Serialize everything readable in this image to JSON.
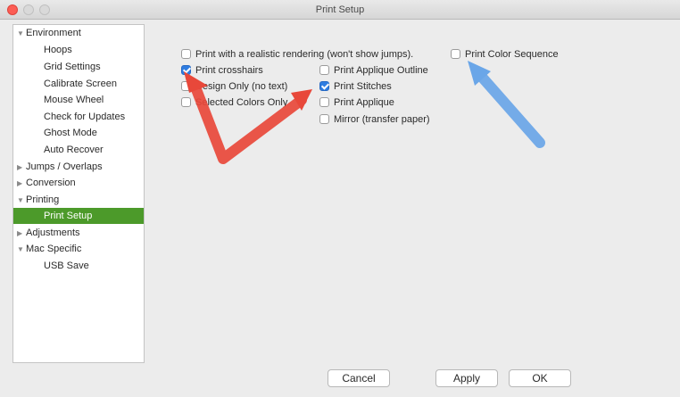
{
  "window": {
    "title": "Print Setup"
  },
  "sidebar": {
    "items": [
      {
        "label": "Environment",
        "expander": "open"
      },
      {
        "label": "Hoops"
      },
      {
        "label": "Grid Settings"
      },
      {
        "label": "Calibrate Screen"
      },
      {
        "label": "Mouse Wheel"
      },
      {
        "label": "Check for Updates"
      },
      {
        "label": "Ghost Mode"
      },
      {
        "label": "Auto Recover"
      },
      {
        "label": "Jumps / Overlaps",
        "expander": "closed"
      },
      {
        "label": "Conversion",
        "expander": "closed"
      },
      {
        "label": "Printing",
        "expander": "open"
      },
      {
        "label": "Print Setup",
        "selected": true
      },
      {
        "label": "Adjustments",
        "expander": "closed"
      },
      {
        "label": "Mac Specific",
        "expander": "open"
      },
      {
        "label": "USB Save"
      }
    ]
  },
  "options": {
    "realistic": {
      "label": "Print with a realistic rendering (won't show jumps).",
      "checked": false
    },
    "crosshairs": {
      "label": "Print crosshairs",
      "checked": true
    },
    "design_only": {
      "label": "Design Only (no text)",
      "checked": false
    },
    "selected_colors": {
      "label": "Selected Colors Only",
      "checked": false
    },
    "applique_outline": {
      "label": "Print Applique Outline",
      "checked": false
    },
    "stitches": {
      "label": "Print Stitches",
      "checked": true
    },
    "applique": {
      "label": "Print Applique",
      "checked": false
    },
    "mirror": {
      "label": "Mirror (transfer paper)",
      "checked": false
    },
    "color_sequence": {
      "label": "Print Color Sequence",
      "checked": false
    }
  },
  "buttons": {
    "cancel": "Cancel",
    "apply": "Apply",
    "ok": "OK"
  },
  "annotation_colors": {
    "red_arrow": "#e8483a",
    "blue_arrow": "#6aa6e8"
  }
}
